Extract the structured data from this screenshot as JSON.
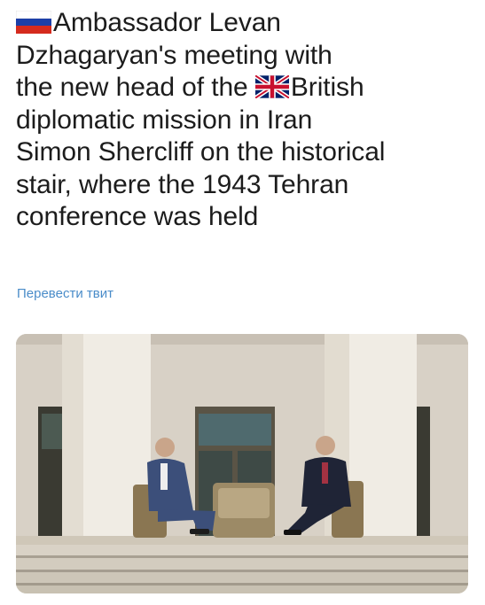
{
  "tweet": {
    "lines": [
      "Ambassador Levan",
      "Dzhagaryan's meeting with",
      "the new head of the ",
      "British",
      "diplomatic mission in Iran",
      "Simon Shercliff on the historical",
      "stair, where the 1943 Tehran",
      "conference was held"
    ],
    "flags": {
      "first": "russia-flag",
      "second": "uk-flag"
    }
  },
  "translate_link": "Перевести твит",
  "photo": {
    "alt_semantic": "two men seated in chairs on a stone staircase between white columns"
  },
  "colors": {
    "text": "#1c1c1c",
    "link": "#4a8cc9"
  }
}
